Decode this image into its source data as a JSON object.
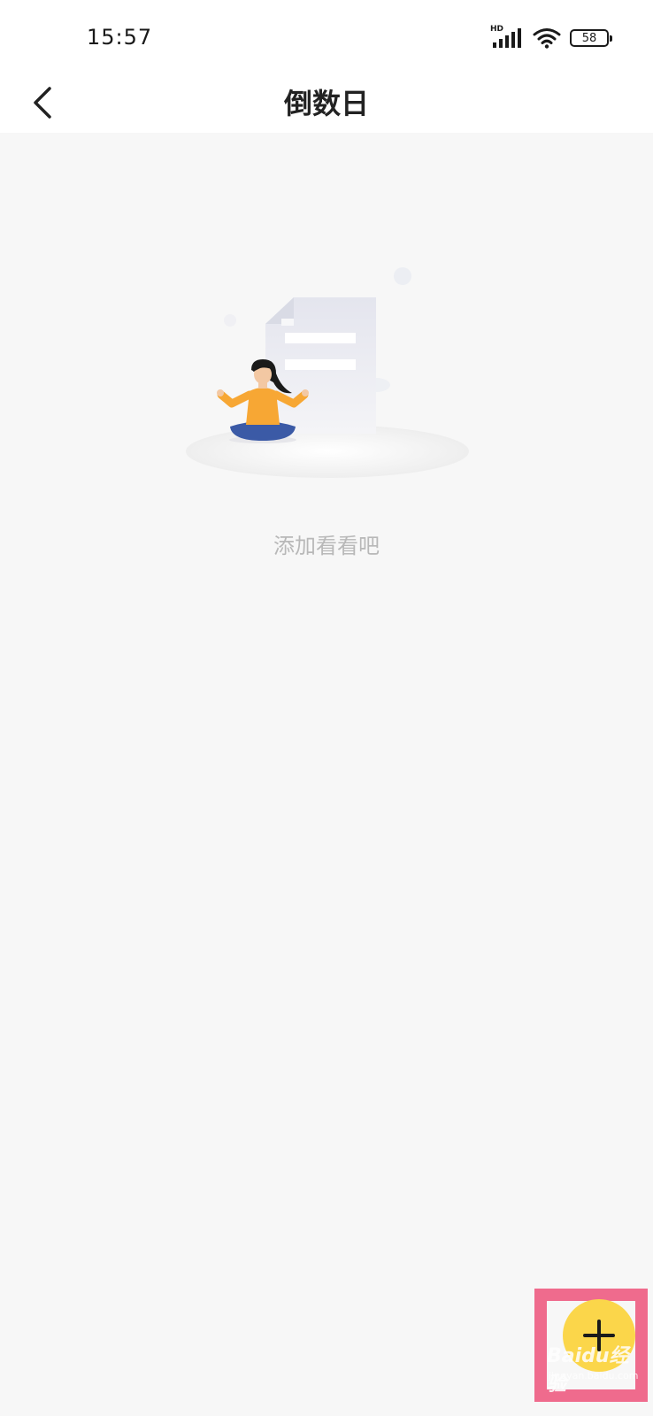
{
  "status_bar": {
    "time": "15:57",
    "network_label": "HD",
    "battery_level": "58",
    "icons": [
      "hd-signal-icon",
      "wifi-icon",
      "battery-icon"
    ]
  },
  "nav": {
    "title": "倒数日",
    "back_icon": "chevron-left-icon"
  },
  "empty_state": {
    "message": "添加看看吧",
    "illustration": "person-meditating-with-document"
  },
  "fab": {
    "icon": "plus-icon",
    "color": "#fbd64a"
  },
  "watermark": {
    "brand": "Baidu经验",
    "url": "jingyan.baidu.com"
  },
  "colors": {
    "background": "#f7f7f7",
    "highlight": "#ef6b8d",
    "empty_text": "#b8b8b8"
  }
}
